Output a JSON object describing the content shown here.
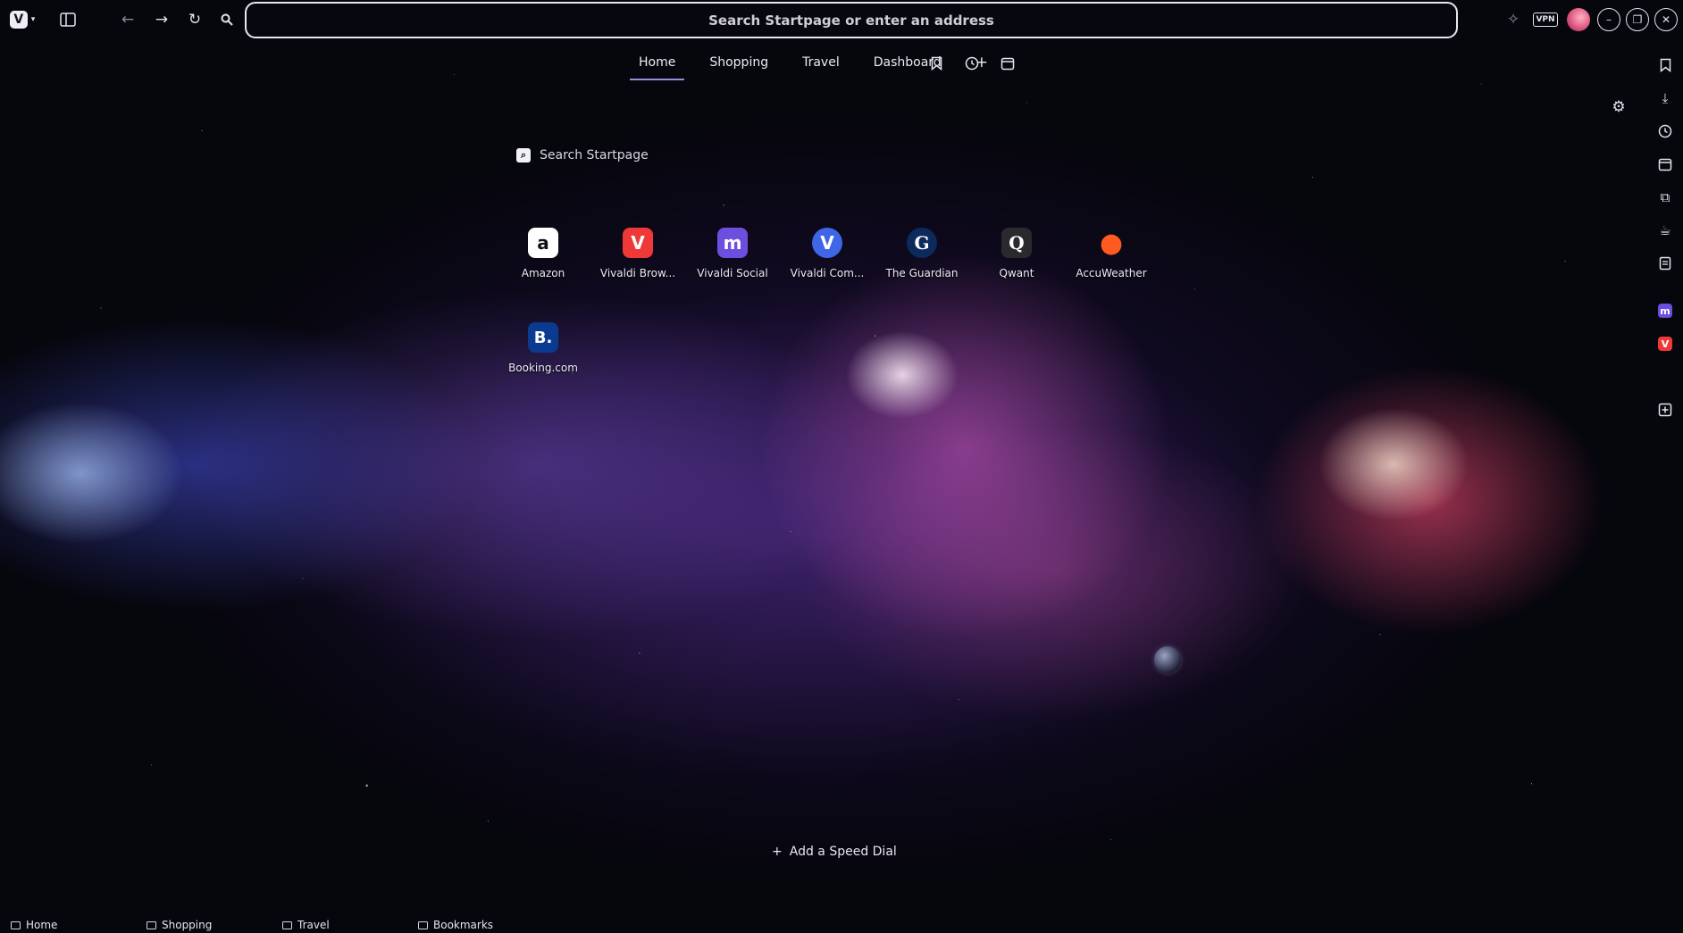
{
  "toolbar": {
    "address_placeholder": "Search Startpage or enter an address",
    "vpn_label": "VPN",
    "vivaldi_menu_icon": "vivaldi-logo-icon",
    "icons": [
      "panel-toggle-icon",
      "back-icon",
      "forward-icon",
      "reload-icon",
      "search-icon",
      "extensions-icon",
      "minimize-icon",
      "restore-icon",
      "close-icon"
    ]
  },
  "tabs": {
    "items": [
      {
        "label": "Home",
        "active": true
      },
      {
        "label": "Shopping",
        "active": false
      },
      {
        "label": "Travel",
        "active": false
      },
      {
        "label": "Dashboard",
        "active": false
      }
    ],
    "add_label": "+"
  },
  "search": {
    "placeholder": "Search Startpage"
  },
  "speed_dials": [
    {
      "label": "Amazon",
      "icon": "a",
      "bg": "#ffffff",
      "fg": "#111111"
    },
    {
      "label": "Vivaldi Brow...",
      "icon": "V",
      "bg": "#ef3939",
      "fg": "#ffffff"
    },
    {
      "label": "Vivaldi Social",
      "icon": "m",
      "bg": "#6d4fe0",
      "fg": "#ffffff"
    },
    {
      "label": "Vivaldi Com...",
      "icon": "V",
      "bg": "#3e66e6",
      "fg": "#ffffff"
    },
    {
      "label": "The Guardian",
      "icon": "G",
      "bg": "#0c2a5c",
      "fg": "#ffffff"
    },
    {
      "label": "Qwant",
      "icon": "Q",
      "bg": "#2a2a2e",
      "fg": "#ffffff"
    },
    {
      "label": "AccuWeather",
      "icon": "●",
      "bg": "transparent",
      "fg": "#ff5a1f"
    },
    {
      "label": "Booking.com",
      "icon": "B.",
      "bg": "#0b3b91",
      "fg": "#ffffff"
    }
  ],
  "add_speed_dial": {
    "icon": "+",
    "label": "Add a Speed Dial"
  },
  "bookmarks_bar": [
    {
      "label": "Home"
    },
    {
      "label": "Shopping"
    },
    {
      "label": "Travel"
    },
    {
      "label": "Bookmarks"
    }
  ]
}
